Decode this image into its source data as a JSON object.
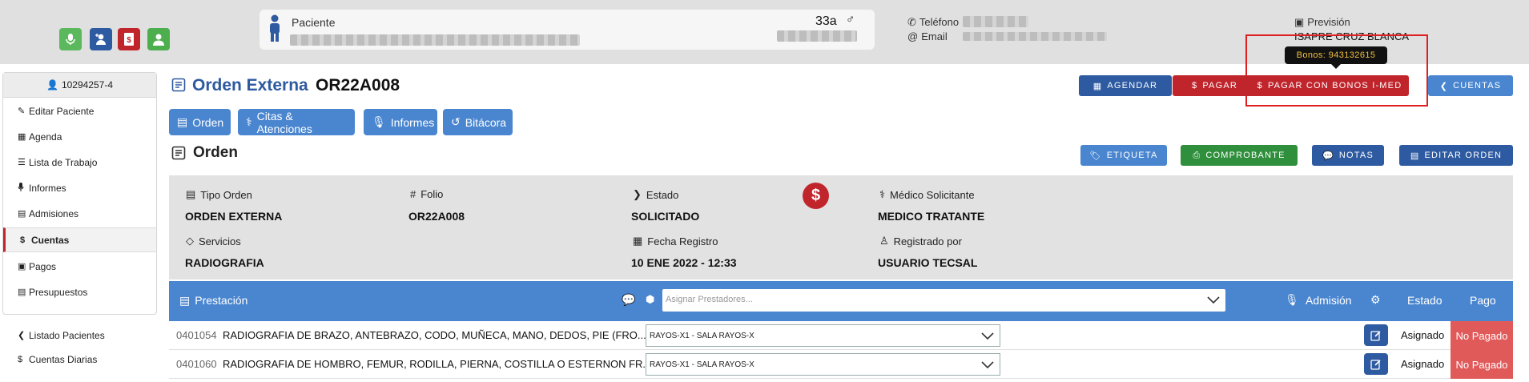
{
  "header": {
    "patient_label": "Paciente",
    "age": "33a",
    "gender_symbol": "♂",
    "phone_label": "Teléfono",
    "email_label": "Email",
    "prevision_label": "Previsión",
    "prevision_value": "ISAPRE CRUZ BLANCA",
    "tooltip": "Bonos: 943132615",
    "quick_actions": [
      {
        "icon": "microphone-icon",
        "color": "#5cb85c"
      },
      {
        "icon": "user-plus-icon",
        "color": "#2d5aa0"
      },
      {
        "icon": "dollar-doc-icon",
        "color": "#c0252c"
      },
      {
        "icon": "user-icon",
        "color": "#4cae4c"
      }
    ]
  },
  "sidebar": {
    "patient_id": "10294257-4",
    "items": [
      {
        "label": "Editar Paciente",
        "icon": "pencil-icon",
        "glyph": "✎"
      },
      {
        "label": "Agenda",
        "icon": "calendar-icon",
        "glyph": "▦"
      },
      {
        "label": "Lista de Trabajo",
        "icon": "list-icon",
        "glyph": "☰"
      },
      {
        "label": "Informes",
        "icon": "microphone-icon",
        "glyph": "🎙"
      },
      {
        "label": "Admisiones",
        "icon": "clipboard-icon",
        "glyph": "▤"
      },
      {
        "label": "Cuentas",
        "icon": "dollar-icon",
        "glyph": "$",
        "active": true
      },
      {
        "label": "Pagos",
        "icon": "money-icon",
        "glyph": "▣"
      },
      {
        "label": "Presupuestos",
        "icon": "list-alt-icon",
        "glyph": "▤"
      }
    ],
    "bottom_items": [
      {
        "label": "Listado Pacientes",
        "icon": "chevron-left-icon",
        "glyph": "❮"
      },
      {
        "label": "Cuentas Diarias",
        "icon": "dollar-icon",
        "glyph": "$"
      }
    ]
  },
  "page": {
    "title": "Orden Externa",
    "code": "OR22A008",
    "buttons": {
      "agendar": "AGENDAR",
      "pagar": "PAGAR",
      "pagar_bonos": "PAGAR CON BONOS I-MED",
      "cuentas": "CUENTAS"
    },
    "tabs": [
      "Orden",
      "Citas & Atenciones",
      "Informes",
      "Bitácora"
    ],
    "section_title": "Orden",
    "actions": {
      "etiqueta": "ETIQUETA",
      "comprobante": "COMPROBANTE",
      "notas": "NOTAS",
      "editar": "EDITAR ORDEN"
    }
  },
  "order": {
    "tipo_label": "Tipo Orden",
    "tipo_value": "ORDEN EXTERNA",
    "folio_label": "Folio",
    "folio_value": "OR22A008",
    "estado_label": "Estado",
    "estado_value": "SOLICITADO",
    "medico_label": "Médico Solicitante",
    "medico_value": "MEDICO TRATANTE",
    "servicios_label": "Servicios",
    "servicios_value": "RADIOGRAFIA",
    "fecha_label": "Fecha Registro",
    "fecha_value": "10 ENE 2022 - 12:33",
    "registrado_label": "Registrado por",
    "registrado_value": "USUARIO TECSAL"
  },
  "table": {
    "headers": {
      "prestacion": "Prestación",
      "asignar_placeholder": "Asignar Prestadores...",
      "admision": "Admisión",
      "estado": "Estado",
      "pago": "Pago"
    },
    "rows": [
      {
        "code": "0401054",
        "desc": "RADIOGRAFIA DE BRAZO, ANTEBRAZO, CODO, MUÑECA, MANO, DEDOS, PIE (FRO...",
        "sala": "RAYOS-X1 - SALA RAYOS-X",
        "estado": "Asignado",
        "pago": "No Pagado"
      },
      {
        "code": "0401060",
        "desc": "RADIOGRAFIA DE HOMBRO, FEMUR, RODILLA, PIERNA, COSTILLA O ESTERNON FR...",
        "sala": "RAYOS-X1 - SALA RAYOS-X",
        "estado": "Asignado",
        "pago": "No Pagado"
      }
    ]
  },
  "colors": {
    "primary": "#2d5aa0",
    "secondary": "#4a86d0",
    "danger": "#c0252c",
    "success": "#2f8f3c",
    "unpaid": "#e05a5a"
  }
}
